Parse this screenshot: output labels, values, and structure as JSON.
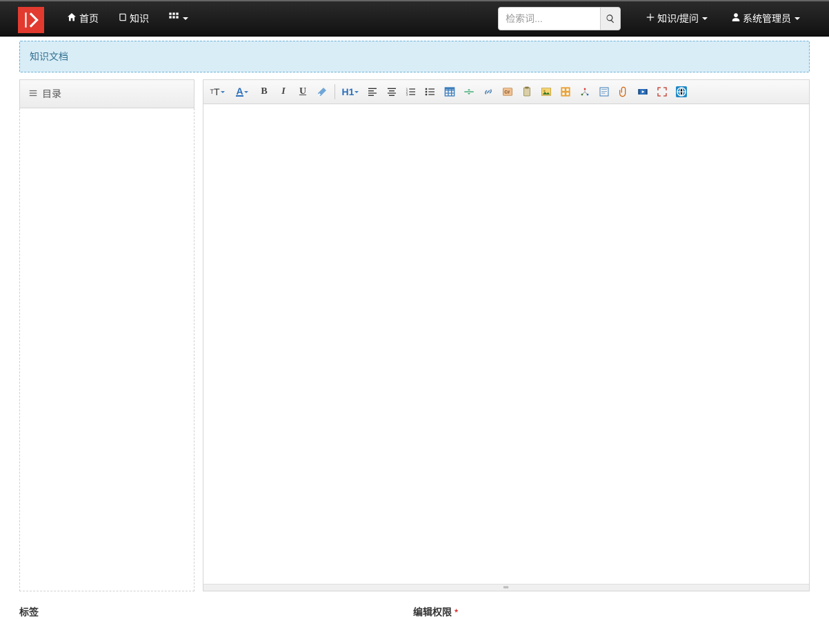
{
  "nav": {
    "home": "首页",
    "knowledge": "知识",
    "search_placeholder": "检索词...",
    "new_menu": "知识/提问",
    "user": "系统管理员"
  },
  "banner": {
    "title": "知识文档"
  },
  "sidebar": {
    "toc_label": "目录"
  },
  "toolbar": {
    "font_size": "tT",
    "font_color": "A",
    "H1": "H1"
  },
  "fields": {
    "tags_label": "标签",
    "perm_label": "编辑权限",
    "required_mark": "*"
  },
  "resize_grip": "⋮⋮"
}
